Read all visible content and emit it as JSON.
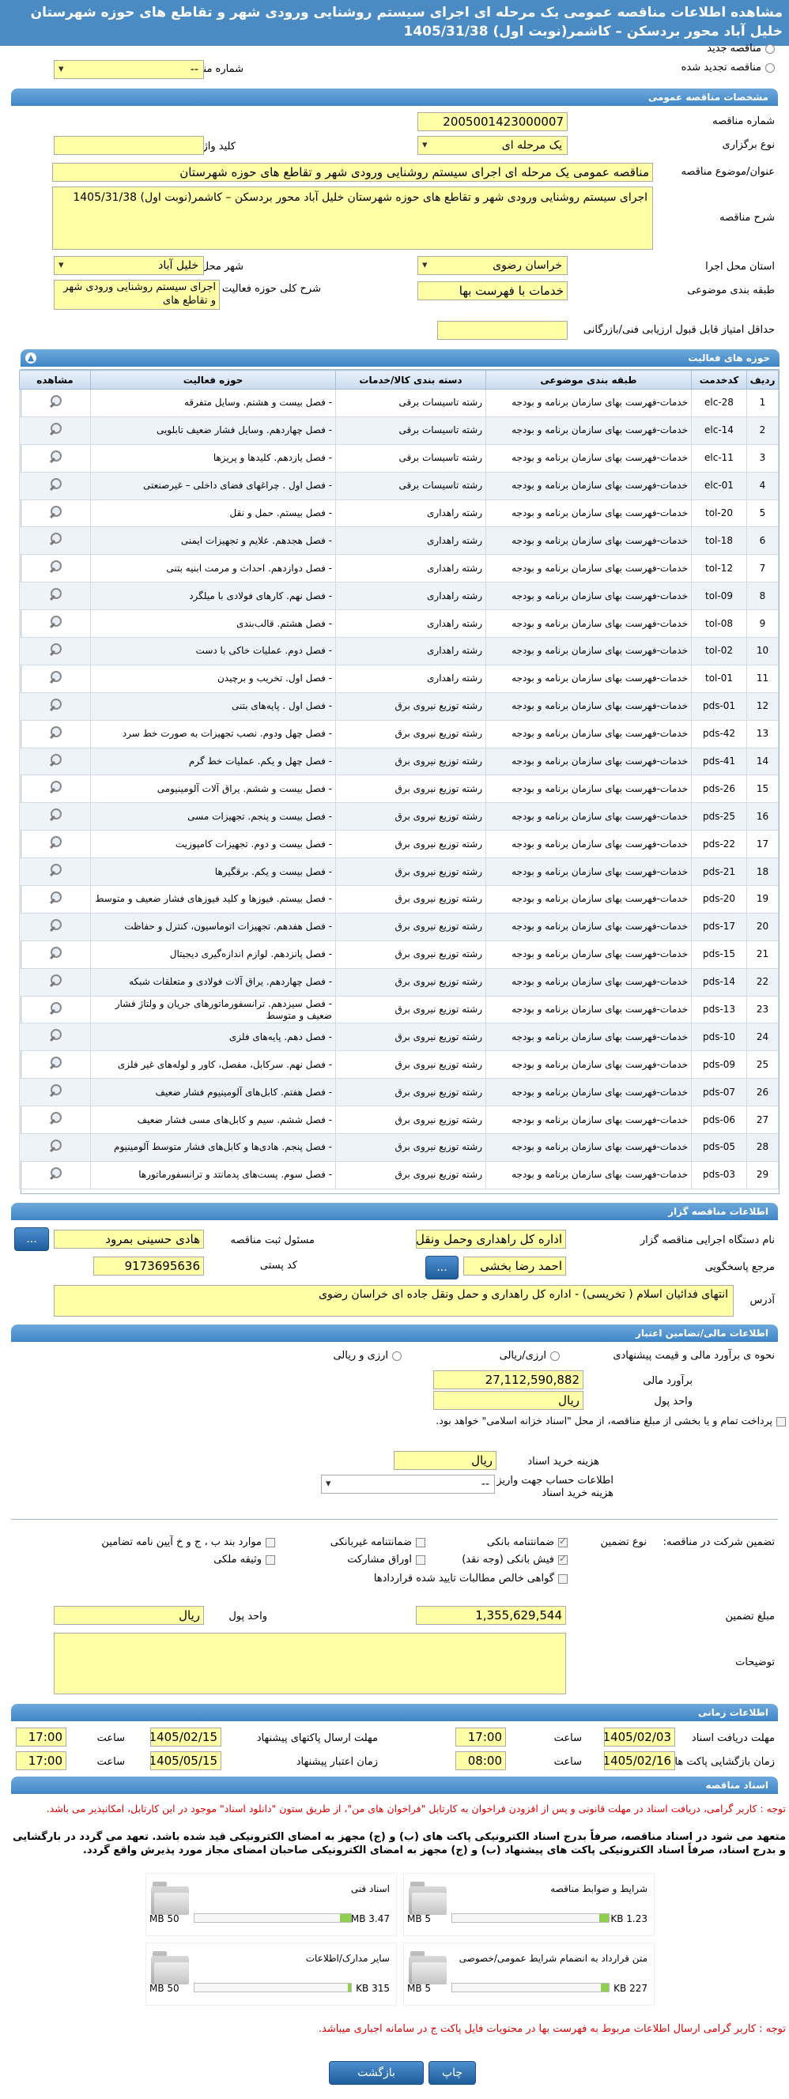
{
  "header": {
    "title": "مشاهده اطلاعات مناقصه عمومی یک مرحله ای اجرای سیستم روشنایی ورودی شهر و تقاطع های حوزه شهرستان خلیل آباد محور بردسکن – کاشمر(نوبت اول) 1405/31/38"
  },
  "tender_type": {
    "new_label": "مناقصه جدید",
    "renew_label": "مناقصه تجدید شده",
    "prev_number_label": "شماره مناقصه قبلی",
    "prev_number_value": "--"
  },
  "general": {
    "section_title": "مشخصات مناقصه عمومی",
    "number_label": "شماره مناقصه",
    "number_value": "2005001423000007",
    "method_label": "نوع برگزاری",
    "method_value": "یک مرحله ای",
    "keyword_label": "کلید واژه",
    "keyword_value": "",
    "title_label": "عنوان/موضوع مناقصه",
    "title_value": "مناقصه عمومی یک مرحله ای اجرای سیستم روشنایی ورودی شهر و تقاطع های حوزه شهرستان",
    "desc_label": "شرح مناقصه",
    "desc_value": "اجرای سیستم روشنایی ورودی شهر و تقاطع های حوزه شهرستان خلیل آباد محور بردسکن – کاشمر(نوبت اول) 1405/31/38",
    "province_label": "استان محل اجرا",
    "province_value": "خراسان رضوی",
    "city_label": "شهر محل اجرا",
    "city_value": "خلیل آباد",
    "category_label": "طبقه بندی موضوعی",
    "category_value": "خدمات با فهرست بها",
    "scope_label": "شرح کلی حوزه فعالیت",
    "scope_value": "اجرای سیستم روشنایی ورودی شهر و تقاطع های",
    "min_score_label": "حداقل امتیاز قابل قبول ارزیابی فنی/بازرگانی",
    "min_score_value": ""
  },
  "activities": {
    "section_title": "حوزه های فعالیت",
    "columns": [
      "ردیف",
      "کدخدمت",
      "طبقه بندی موضوعی",
      "دسته بندی کالا/خدمات",
      "حوزه فعالیت",
      "مشاهده"
    ],
    "rows": [
      {
        "n": "1",
        "code": "elc-28",
        "cat": "خدمات-فهرست بهای سازمان برنامه و بودجه",
        "group": "رشته تاسیسات برقی",
        "field": "- فصل بیست و هشتم. وسایل متفرقه"
      },
      {
        "n": "2",
        "code": "elc-14",
        "cat": "خدمات-فهرست بهای سازمان برنامه و بودجه",
        "group": "رشته تاسیسات برقی",
        "field": "- فصل چهاردهم. وسایل فشار ضعیف تابلویی"
      },
      {
        "n": "3",
        "code": "elc-11",
        "cat": "خدمات-فهرست بهای سازمان برنامه و بودجه",
        "group": "رشته تاسیسات برقی",
        "field": "- فصل یازدهم. کلیدها و پریزها"
      },
      {
        "n": "4",
        "code": "elc-01",
        "cat": "خدمات-فهرست بهای سازمان برنامه و بودجه",
        "group": "رشته تاسیسات برقی",
        "field": "- فصل اول . چراغهای فضای داخلی – غیرصنعتی"
      },
      {
        "n": "5",
        "code": "tol-20",
        "cat": "خدمات-فهرست بهای سازمان برنامه و بودجه",
        "group": "رشته راهداری",
        "field": "- فصل بیستم. حمل و نقل"
      },
      {
        "n": "6",
        "code": "tol-18",
        "cat": "خدمات-فهرست بهای سازمان برنامه و بودجه",
        "group": "رشته راهداری",
        "field": "- فصل هجدهم. علایم و تجهیزات ایمنی"
      },
      {
        "n": "7",
        "code": "tol-12",
        "cat": "خدمات-فهرست بهای سازمان برنامه و بودجه",
        "group": "رشته راهداری",
        "field": "- فصل دوازدهم. احداث و مرمت ابنیه بتنی"
      },
      {
        "n": "8",
        "code": "tol-09",
        "cat": "خدمات-فهرست بهای سازمان برنامه و بودجه",
        "group": "رشته راهداری",
        "field": "- فصل نهم. کارهای فولادی با میلگرد"
      },
      {
        "n": "9",
        "code": "tol-08",
        "cat": "خدمات-فهرست بهای سازمان برنامه و بودجه",
        "group": "رشته راهداری",
        "field": "- فصل هشتم. قالب‌بندی"
      },
      {
        "n": "10",
        "code": "tol-02",
        "cat": "خدمات-فهرست بهای سازمان برنامه و بودجه",
        "group": "رشته راهداری",
        "field": "- فصل دوم. عملیات خاکی با دست"
      },
      {
        "n": "11",
        "code": "tol-01",
        "cat": "خدمات-فهرست بهای سازمان برنامه و بودجه",
        "group": "رشته راهداری",
        "field": "- فصل اول. تخریب و برچیدن"
      },
      {
        "n": "12",
        "code": "pds-01",
        "cat": "خدمات-فهرست بهای سازمان برنامه و بودجه",
        "group": "رشته توزیع نیروی برق",
        "field": "- فصل اول . پایه‌های بتنی"
      },
      {
        "n": "13",
        "code": "pds-42",
        "cat": "خدمات-فهرست بهای سازمان برنامه و بودجه",
        "group": "رشته توزیع نیروی برق",
        "field": "- فصل چهل ودوم. نصب تجهیزات به صورت خط سرد"
      },
      {
        "n": "14",
        "code": "pds-41",
        "cat": "خدمات-فهرست بهای سازمان برنامه و بودجه",
        "group": "رشته توزیع نیروی برق",
        "field": "- فصل چهل و یکم. عملیات خط گرم"
      },
      {
        "n": "15",
        "code": "pds-26",
        "cat": "خدمات-فهرست بهای سازمان برنامه و بودجه",
        "group": "رشته توزیع نیروی برق",
        "field": "- فصل بیست و ششم. یراق آلات آلومینیومی"
      },
      {
        "n": "16",
        "code": "pds-25",
        "cat": "خدمات-فهرست بهای سازمان برنامه و بودجه",
        "group": "رشته توزیع نیروی برق",
        "field": "- فصل بیست و پنجم. تجهیزات مسی"
      },
      {
        "n": "17",
        "code": "pds-22",
        "cat": "خدمات-فهرست بهای سازمان برنامه و بودجه",
        "group": "رشته توزیع نیروی برق",
        "field": "- فصل بیست و دوم. تجهیزات کامپوزیت"
      },
      {
        "n": "18",
        "code": "pds-21",
        "cat": "خدمات-فهرست بهای سازمان برنامه و بودجه",
        "group": "رشته توزیع نیروی برق",
        "field": "- فصل بیست و یکم. برقگیرها"
      },
      {
        "n": "19",
        "code": "pds-20",
        "cat": "خدمات-فهرست بهای سازمان برنامه و بودجه",
        "group": "رشته توزیع نیروی برق",
        "field": "- فصل بیستم. فیوزها و کلید فیوزهای فشار ضعیف و متوسط"
      },
      {
        "n": "20",
        "code": "pds-17",
        "cat": "خدمات-فهرست بهای سازمان برنامه و بودجه",
        "group": "رشته توزیع نیروی برق",
        "field": "- فصل هفدهم. تجهیزات اتوماسیون، کنترل و حفاظت"
      },
      {
        "n": "21",
        "code": "pds-15",
        "cat": "خدمات-فهرست بهای سازمان برنامه و بودجه",
        "group": "رشته توزیع نیروی برق",
        "field": "- فصل پانزدهم. لوازم اندازه‌گیری دیجیتال"
      },
      {
        "n": "22",
        "code": "pds-14",
        "cat": "خدمات-فهرست بهای سازمان برنامه و بودجه",
        "group": "رشته توزیع نیروی برق",
        "field": "- فصل چهاردهم. یراق آلات فولادی و متعلقات شبکه"
      },
      {
        "n": "23",
        "code": "pds-13",
        "cat": "خدمات-فهرست بهای سازمان برنامه و بودجه",
        "group": "رشته توزیع نیروی برق",
        "field": "- فصل سیزدهم. ترانسفورماتورهای جریان و ولتاژ فشار ضعیف و متوسط"
      },
      {
        "n": "24",
        "code": "pds-10",
        "cat": "خدمات-فهرست بهای سازمان برنامه و بودجه",
        "group": "رشته توزیع نیروی برق",
        "field": "- فصل دهم. پایه‌های فلزی"
      },
      {
        "n": "25",
        "code": "pds-09",
        "cat": "خدمات-فهرست بهای سازمان برنامه و بودجه",
        "group": "رشته توزیع نیروی برق",
        "field": "- فصل نهم. سرکابل، مفصل، کاور و لوله‌های غیر فلزی"
      },
      {
        "n": "26",
        "code": "pds-07",
        "cat": "خدمات-فهرست بهای سازمان برنامه و بودجه",
        "group": "رشته توزیع نیروی برق",
        "field": "- فصل هفتم. کابل‌های آلومینیوم فشار ضعیف"
      },
      {
        "n": "27",
        "code": "pds-06",
        "cat": "خدمات-فهرست بهای سازمان برنامه و بودجه",
        "group": "رشته توزیع نیروی برق",
        "field": "- فصل ششم. سیم و کابل‌های مسی فشار ضعیف"
      },
      {
        "n": "28",
        "code": "pds-05",
        "cat": "خدمات-فهرست بهای سازمان برنامه و بودجه",
        "group": "رشته توزیع نیروی برق",
        "field": "- فصل پنجم. هادی‌ها و کابل‌های فشار متوسط آلومینیوم"
      },
      {
        "n": "29",
        "code": "pds-03",
        "cat": "خدمات-فهرست بهای سازمان برنامه و بودجه",
        "group": "رشته توزیع نیروی برق",
        "field": "- فصل سوم. پست‌های پدمانتد و ترانسفورماتورها"
      }
    ]
  },
  "organizer": {
    "section_title": "اطلاعات مناقصه گزار",
    "org_label": "نام دستگاه اجرایی مناقصه گزار",
    "org_value": "اداره کل راهداری وحمل ونقل",
    "officer_label": "مسئول ثبت مناقصه",
    "officer_value": "هادی حسینی بمرود",
    "officer_btn": "...",
    "ref_label": "مرجع پاسخگویی",
    "ref_value": "احمد رضا بخشی",
    "ref_btn": "...",
    "postal_label": "کد پستی",
    "postal_value": "9173695636",
    "address_label": "آدرس",
    "address_value": "انتهای فدائیان اسلام ( تخریسی) - اداره کل راهداری و حمل ونقل جاده ای خراسان رضوی"
  },
  "financial": {
    "section_title": "اطلاعات مالی/تضامین اعتبار",
    "method_label": "نحوه ی برآورد مالی و قیمت پیشنهادی",
    "opt_rial": "ارزی/ریالی",
    "opt_fx_rial": "ارزی و ریالی",
    "estimate_label": "برآورد مالی",
    "estimate_value": "27,112,590,882",
    "currency_label": "واحد پول",
    "currency_value": "ریال",
    "payment_note": "پرداخت تمام و یا بخشی از مبلغ مناقصه، از محل \"اسناد خزانه اسلامی\" خواهد بود.",
    "doc_fee_label": "هزینه خرید اسناد",
    "doc_fee_unit": "ریال",
    "account_label": "اطلاعات حساب جهت واریز هزینه خرید اسناد",
    "account_value": "--"
  },
  "guarantee": {
    "type_label": "تضمین شرکت در مناقصه:",
    "kind_label": "نوع تضمین",
    "opts": {
      "bank": "ضمانتنامه بانکی",
      "nonbank": "ضمانتنامه غیربانکی",
      "clauses": "موارد بند ب ، ج و خ آیین نامه تضامین",
      "cheque": "فیش بانکی (وجه نقد)",
      "securities": "اوراق مشارکت",
      "property": "وثیقه ملکی",
      "certificate": "گواهی خالص مطالبات تایید شده قراردادها"
    },
    "amount_label": "مبلغ تضمین",
    "amount_value": "1,355,629,544",
    "currency_label": "واحد پول",
    "currency_value": "ریال",
    "notes_label": "توضیحات",
    "notes_value": ""
  },
  "timing": {
    "section_title": "اطلاعات زمانی",
    "receive_deadline_label": "مهلت دریافت اسناد",
    "receive_deadline_date": "1405/02/03",
    "receive_deadline_time": "17:00",
    "send_deadline_label": "مهلت ارسال پاکتهای پیشنهاد",
    "send_deadline_date": "1405/02/15",
    "send_deadline_time": "17:00",
    "opening_label": "زمان بازگشایی پاکت های ج",
    "opening_date": "1405/02/16",
    "opening_time": "08:00",
    "validity_label": "زمان اعتبار پیشنهاد",
    "validity_date": "1405/05/15",
    "validity_time": "17:00",
    "time_label": "ساعت"
  },
  "documents": {
    "section_title": "اسناد مناقصه",
    "notice1": "توجه : کاربر گرامی، دریافت اسناد در مهلت قانونی و پس از افزودن فراخوان به کارتابل \"فراخوان های من\"، از طریق ستون \"دانلود اسناد\" موجود در این کارتابل، امکانپذیر می باشد.",
    "notice2": "متعهد می شود در اسناد مناقصه، صرفاً بدرج اسناد الکترونیکی پاکت های (ب) و (ج) مجهز به امضای الکترونیکی قید شده باشد. تعهد می گردد در بارگشایی و بدرج اسناد، صرفاً اسناد الکترونیکی پاکت های پیشنهاد (ب) و (ج) مجهز به امضای الکترونیکی صاحبان امضای مجاز مورد پذیرش واقع گردد.",
    "items": [
      {
        "title": "شرایط و ضوابط مناقصه",
        "size": "1.23 KB",
        "max": "5 MB",
        "fill": 0.06
      },
      {
        "title": "اسناد فنی",
        "size": "3.47 MB",
        "max": "50 MB",
        "fill": 0.07
      },
      {
        "title": "متن قرارداد به انضمام شرایط عمومی/خصوصی",
        "size": "227 KB",
        "max": "5 MB",
        "fill": 0.05
      },
      {
        "title": "سایر مدارک/اطلاعات",
        "size": "315 KB",
        "max": "50 MB",
        "fill": 0.01
      }
    ],
    "notice3": "توجه : کاربر گرامی ارسال اطلاعات مربوط به فهرست بها در محتویات فایل پاکت ج در سامانه اجباری میباشد."
  },
  "footer": {
    "print_btn": "چاپ",
    "back_btn": "بازگشت"
  }
}
